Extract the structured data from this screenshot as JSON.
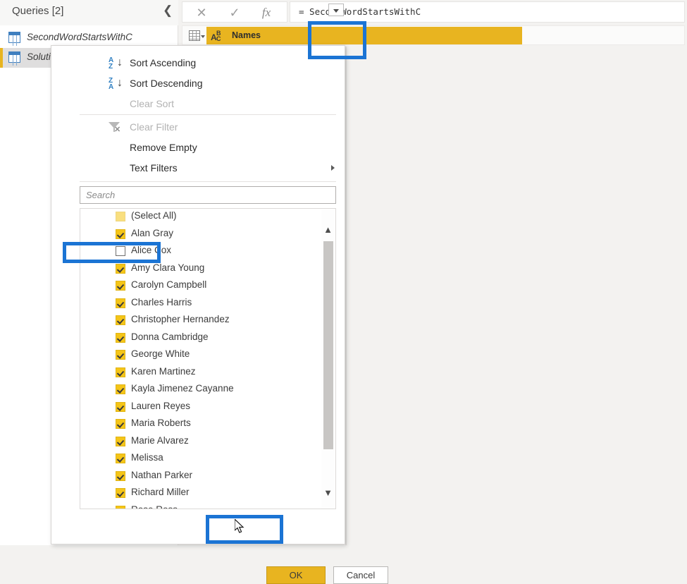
{
  "queries_pane": {
    "title": "Queries [2]",
    "collapse_icon": "chevron-left-icon",
    "items": [
      {
        "label": "SecondWordStartsWithC",
        "selected": false
      },
      {
        "label": "Solutions",
        "selected": true
      }
    ]
  },
  "formula_bar": {
    "cancel_icon": "close-icon",
    "accept_icon": "check-icon",
    "fx_icon": "fx-icon",
    "formula": "= SecondWordStartsWithC"
  },
  "table_header": {
    "grid_icon": "table-grid-icon",
    "type_icon": "abc-text-type-icon",
    "type_icon_letters": {
      "a": "A",
      "b": "B",
      "c": "C"
    },
    "column_name": "Names",
    "dropdown_icon": "chevron-down-icon",
    "highlight_color": "#e8b420"
  },
  "filter_menu": {
    "items": [
      {
        "id": "sort-ascending",
        "label": "Sort Ascending",
        "icon": "sort-ascending-icon",
        "disabled": false,
        "letters": [
          "A",
          "Z"
        ]
      },
      {
        "id": "sort-descending",
        "label": "Sort Descending",
        "icon": "sort-descending-icon",
        "disabled": false,
        "letters": [
          "Z",
          "A"
        ]
      },
      {
        "id": "clear-sort",
        "label": "Clear Sort",
        "icon": "none",
        "disabled": true
      },
      {
        "id": "clear-filter",
        "label": "Clear Filter",
        "icon": "clear-filter-icon",
        "disabled": true
      },
      {
        "id": "remove-empty",
        "label": "Remove Empty",
        "icon": "none",
        "disabled": false
      },
      {
        "id": "text-filters",
        "label": "Text Filters",
        "icon": "none",
        "disabled": false,
        "submenu": true
      }
    ],
    "search": {
      "placeholder": "Search",
      "value": ""
    },
    "values": [
      {
        "label": "(Select All)",
        "state": "partial"
      },
      {
        "label": "Alan Gray",
        "state": "checked"
      },
      {
        "label": "Alice Cox",
        "state": "unchecked"
      },
      {
        "label": "Amy Clara Young",
        "state": "checked"
      },
      {
        "label": "Carolyn Campbell",
        "state": "checked"
      },
      {
        "label": "Charles Harris",
        "state": "checked"
      },
      {
        "label": "Christopher Hernandez",
        "state": "checked"
      },
      {
        "label": "Donna Cambridge",
        "state": "checked"
      },
      {
        "label": "George White",
        "state": "checked"
      },
      {
        "label": "Karen Martinez",
        "state": "checked"
      },
      {
        "label": "Kayla Jimenez Cayanne",
        "state": "checked"
      },
      {
        "label": "Lauren Reyes",
        "state": "checked"
      },
      {
        "label": "Maria Roberts",
        "state": "checked"
      },
      {
        "label": "Marie Alvarez",
        "state": "checked"
      },
      {
        "label": "Melissa",
        "state": "checked"
      },
      {
        "label": "Nathan Parker",
        "state": "checked"
      },
      {
        "label": "Richard Miller",
        "state": "checked"
      },
      {
        "label": "Rose Ross",
        "state": "checked"
      }
    ],
    "scroll_up_icon": "chevron-up-icon",
    "scroll_down_icon": "chevron-down-icon",
    "ok_label": "OK",
    "cancel_label": "Cancel"
  },
  "annotations": {
    "color": "#1b74d4",
    "boxes": [
      {
        "name": "dropdown-highlight",
        "target": "filter dropdown button"
      },
      {
        "name": "alice-cox-highlight",
        "target": "Alice Cox unchecked item"
      },
      {
        "name": "ok-button-highlight",
        "target": "OK button"
      }
    ]
  }
}
